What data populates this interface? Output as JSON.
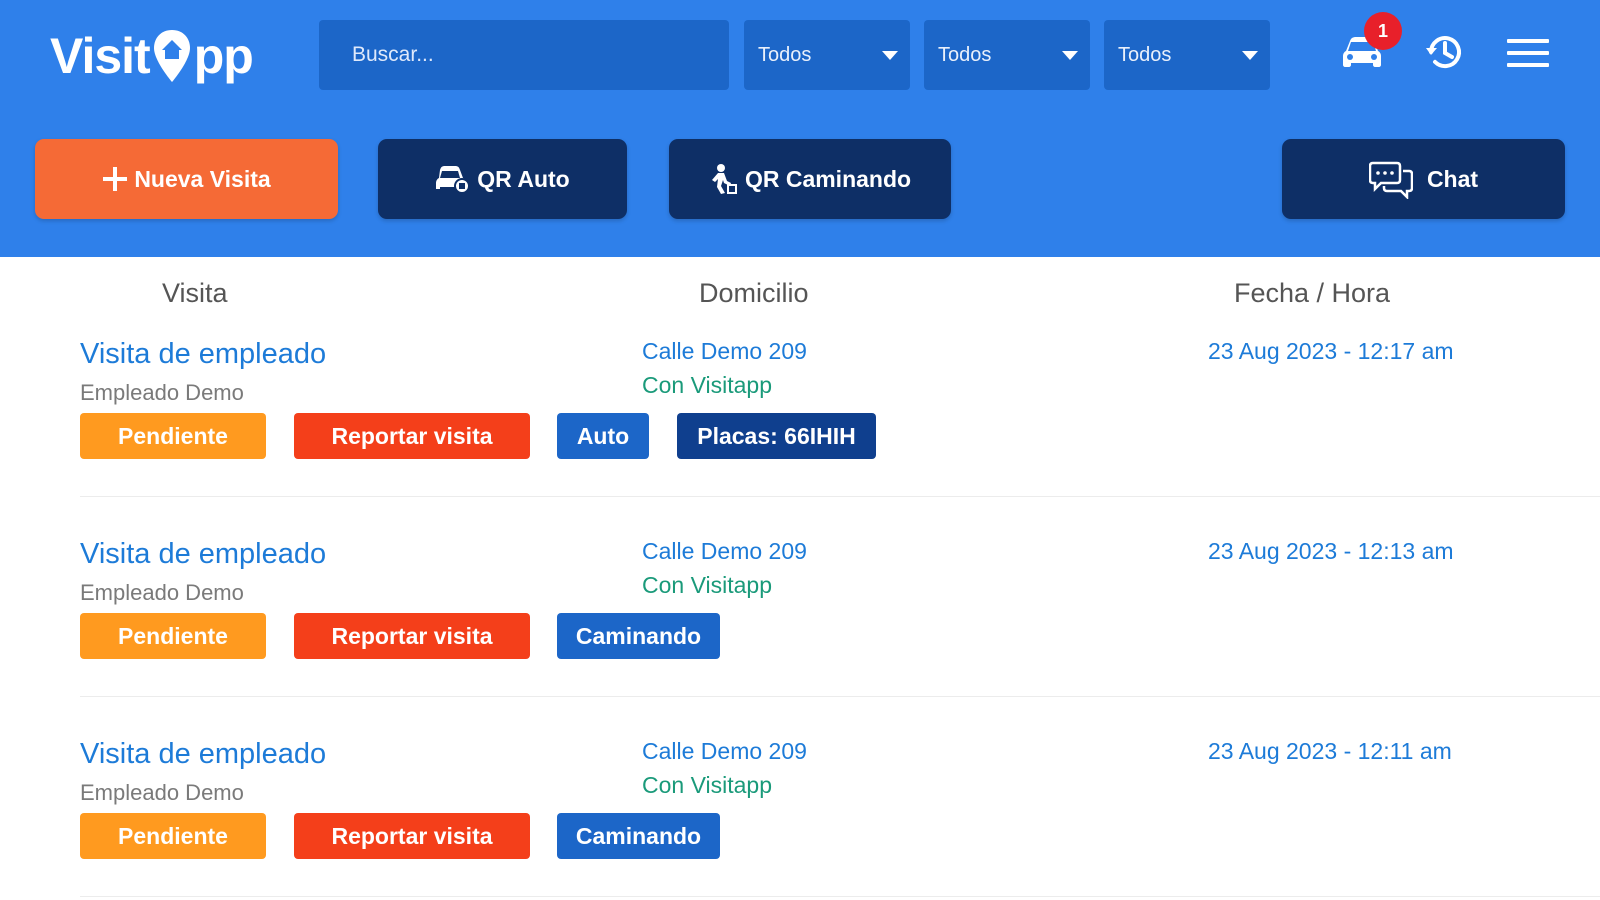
{
  "app": {
    "logo_text_left": "Visit",
    "logo_text_right": "pp"
  },
  "search": {
    "placeholder": "Buscar...",
    "value": ""
  },
  "filters": [
    {
      "value": "Todos"
    },
    {
      "value": "Todos"
    },
    {
      "value": "Todos"
    }
  ],
  "header_icons": {
    "car_badge_count": "1"
  },
  "actions": {
    "new_visit": "Nueva Visita",
    "qr_auto": "QR Auto",
    "qr_walking": "QR Caminando",
    "chat": "Chat"
  },
  "columns": {
    "visit": "Visita",
    "address": "Domicilio",
    "datetime": "Fecha / Hora"
  },
  "visits": [
    {
      "title": "Visita de empleado",
      "person": "Empleado Demo",
      "address": "Calle Demo 209",
      "address_note": "Con Visitapp",
      "datetime": "23 Aug 2023 - 12:17 am",
      "status": "Pendiente",
      "report": "Reportar visita",
      "mode": "Auto",
      "plates": "Placas: 66IHIH"
    },
    {
      "title": "Visita de empleado",
      "person": "Empleado Demo",
      "address": "Calle Demo 209",
      "address_note": "Con Visitapp",
      "datetime": "23 Aug 2023 - 12:13 am",
      "status": "Pendiente",
      "report": "Reportar visita",
      "mode": "Caminando"
    },
    {
      "title": "Visita de empleado",
      "person": "Empleado Demo",
      "address": "Calle Demo 209",
      "address_note": "Con Visitapp",
      "datetime": "23 Aug 2023 - 12:11 am",
      "status": "Pendiente",
      "report": "Reportar visita",
      "mode": "Caminando"
    }
  ],
  "colors": {
    "header_bg": "#2f80ea",
    "accent_orange": "#f56a36",
    "navy": "#0e2f66",
    "link_blue": "#1d7bd8",
    "status_pending": "#ff9a1f",
    "report_red": "#f43f1a"
  },
  "icons": [
    "location-pin-icon",
    "dropdown-caret-icon",
    "car-icon",
    "history-icon",
    "hamburger-menu-icon",
    "plus-icon",
    "car-qr-icon",
    "walking-person-icon",
    "chat-bubbles-icon"
  ]
}
